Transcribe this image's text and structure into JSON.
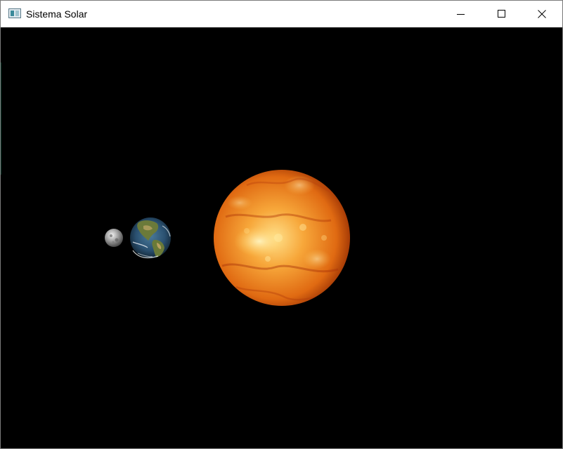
{
  "window": {
    "title": "Sistema Solar",
    "icon": "app-window-icon",
    "controls": {
      "minimize_icon": "minimize-icon",
      "maximize_icon": "maximize-icon",
      "close_icon": "close-icon"
    }
  },
  "scene": {
    "background": "#000000",
    "bodies": [
      {
        "name": "moon",
        "colors": [
          "#f2f2f2",
          "#9a9a9a",
          "#4a4a4a"
        ]
      },
      {
        "name": "earth",
        "colors": [
          "#4a7a9a",
          "#2a5070",
          "#0e1e2a"
        ]
      },
      {
        "name": "sun",
        "colors": [
          "#ffe08a",
          "#f08a1a",
          "#8a2400"
        ]
      }
    ]
  }
}
